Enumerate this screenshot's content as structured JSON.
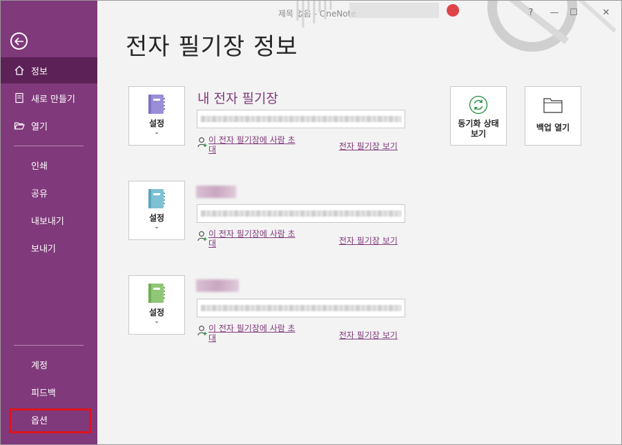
{
  "window": {
    "title": "제목 없음  -  OneNote",
    "controls": [
      "?",
      "—",
      "☐",
      "✕"
    ]
  },
  "sidebar": {
    "items": [
      {
        "label": "정보",
        "icon": "home-icon",
        "active": true
      },
      {
        "label": "새로 만들기",
        "icon": "new-page-icon"
      },
      {
        "label": "열기",
        "icon": "folder-open-icon"
      },
      {
        "label": "인쇄"
      },
      {
        "label": "공유"
      },
      {
        "label": "내보내기"
      },
      {
        "label": "보내기"
      },
      {
        "label": "계정"
      },
      {
        "label": "피드백"
      },
      {
        "label": "옵션"
      }
    ]
  },
  "main": {
    "title": "전자 필기장 정보",
    "notebooks": [
      {
        "name": "내 전자 필기장",
        "color": "#9b8ed8",
        "settings_label": "설정",
        "share_label": "이 전자 필기장에 사람 초대",
        "view_label": "전자 필기장 보기"
      },
      {
        "name": "",
        "color": "#7fc1d4",
        "settings_label": "설정",
        "share_label": "이 전자 필기장에 사람 초대",
        "view_label": "전자 필기장 보기"
      },
      {
        "name": "",
        "color": "#8fc776",
        "settings_label": "설정",
        "share_label": "이 전자 필기장에 사람 초대",
        "view_label": "전자 필기장 보기"
      }
    ],
    "actions": {
      "sync_label": "동기화 상태 보기",
      "backup_label": "백업 열기"
    }
  },
  "colors": {
    "accent": "#80397b",
    "sidebar_active": "#5c2257",
    "highlight": "#e0141b"
  }
}
